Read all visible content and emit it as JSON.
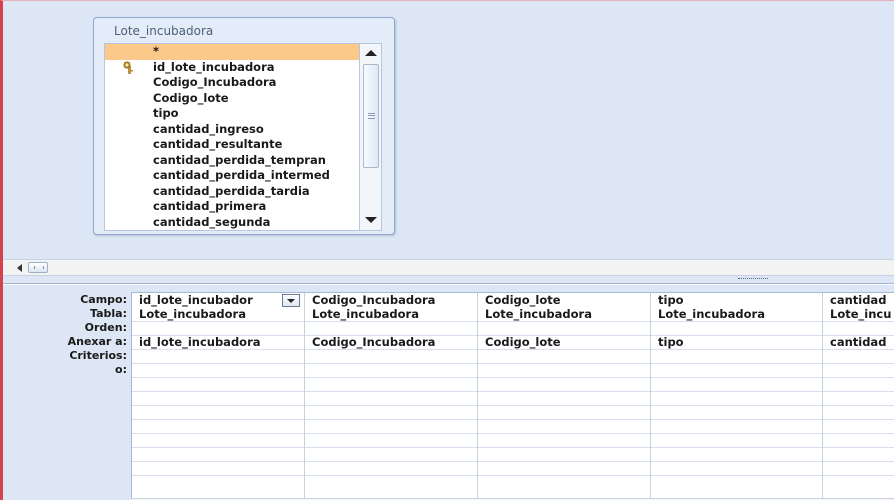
{
  "table": {
    "title": "Lote_incubadora",
    "fields": [
      "*",
      "id_lote_incubadora",
      "Codigo_Incubadora",
      "Codigo_lote",
      "tipo",
      "cantidad_ingreso",
      "cantidad_resultante",
      "cantidad_perdida_tempran",
      "cantidad_perdida_intermed",
      "cantidad_perdida_tardia",
      "cantidad_primera",
      "cantidad_segunda"
    ],
    "primary_key_field": "id_lote_incubadora",
    "icon": "key-icon"
  },
  "grid": {
    "row_labels": [
      "Campo:",
      "Tabla:",
      "Orden:",
      "Anexar a:",
      "Criterios:",
      "o:"
    ],
    "columns": [
      {
        "campo": "id_lote_incubador",
        "tabla": "Lote_incubadora",
        "orden": "",
        "anexar": "id_lote_incubadora",
        "criterios": "",
        "o": ""
      },
      {
        "campo": "Codigo_Incubadora",
        "tabla": "Lote_incubadora",
        "orden": "",
        "anexar": "Codigo_Incubadora",
        "criterios": "",
        "o": ""
      },
      {
        "campo": "Codigo_lote",
        "tabla": "Lote_incubadora",
        "orden": "",
        "anexar": "Codigo_lote",
        "criterios": "",
        "o": ""
      },
      {
        "campo": "tipo",
        "tabla": "Lote_incubadora",
        "orden": "",
        "anexar": "tipo",
        "criterios": "",
        "o": ""
      },
      {
        "campo": "cantidad",
        "tabla": "Lote_incu",
        "orden": "",
        "anexar": "cantidad",
        "criterios": "",
        "o": ""
      }
    ]
  },
  "colors": {
    "pane_background": "#dce6f4",
    "selected_field": "#fbc98a",
    "window_border": "#d6414e"
  }
}
